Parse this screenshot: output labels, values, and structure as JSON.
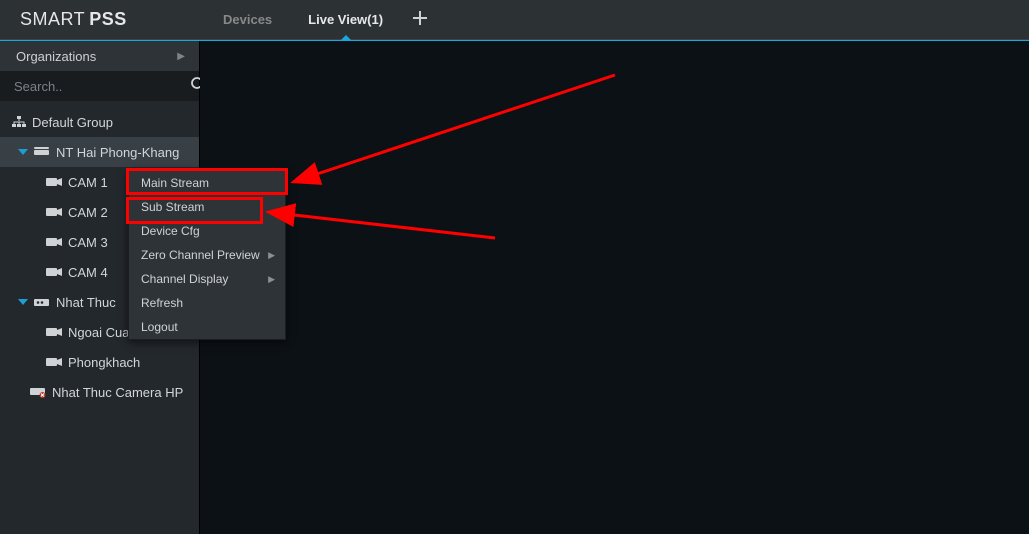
{
  "app": {
    "name_part1": "SMART",
    "name_part2": "PSS"
  },
  "tabs": [
    {
      "label": "Devices",
      "active": false
    },
    {
      "label": "Live View(1)",
      "active": true
    }
  ],
  "sidebar": {
    "org_label": "Organizations",
    "search_placeholder": "Search..",
    "tree": {
      "root_label": "Default Group",
      "nodes": [
        {
          "label": "NT Hai Phong-Khang",
          "expanded": true,
          "selected": true,
          "children": [
            {
              "label": "CAM 1"
            },
            {
              "label": "CAM 2"
            },
            {
              "label": "CAM 3"
            },
            {
              "label": "CAM 4"
            }
          ]
        },
        {
          "label": "Nhat Thuc",
          "expanded": true,
          "children": [
            {
              "label": "Ngoai Cua Nhin Xe"
            },
            {
              "label": "Phongkhach"
            }
          ]
        },
        {
          "label": "Nhat Thuc Camera HP",
          "offline": true
        }
      ]
    }
  },
  "context_menu": {
    "items": [
      {
        "label": "Main Stream"
      },
      {
        "label": "Sub Stream"
      },
      {
        "label": "Device Cfg"
      },
      {
        "label": "Zero Channel Preview",
        "submenu": true
      },
      {
        "label": "Channel Display",
        "submenu": true
      },
      {
        "label": "Refresh"
      },
      {
        "label": "Logout"
      }
    ]
  }
}
